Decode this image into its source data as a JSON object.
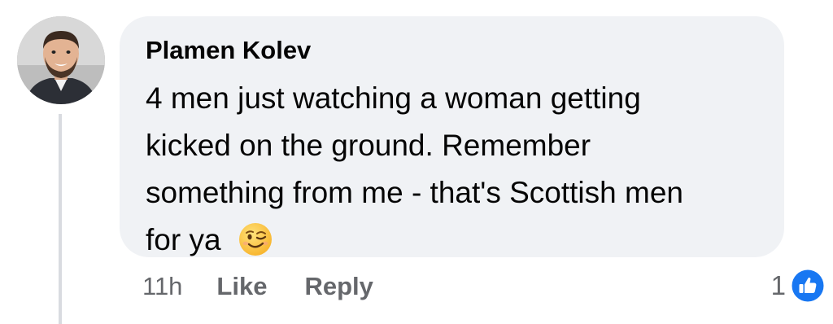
{
  "comment": {
    "author": "Plamen Kolev",
    "lines": [
      "4 men just watching a woman getting",
      "kicked on the ground. Remember",
      "something from me - that's Scottish men",
      "for ya"
    ],
    "emoji": "winking-face-icon",
    "timestamp": "11h",
    "like_label": "Like",
    "reply_label": "Reply",
    "reaction_count": "1",
    "reaction_icon": "thumbs-up-icon"
  },
  "colors": {
    "bubble": "#f0f2f5",
    "text": "#050505",
    "secondary_text": "#65676b",
    "like_blue": "#1877f2"
  }
}
